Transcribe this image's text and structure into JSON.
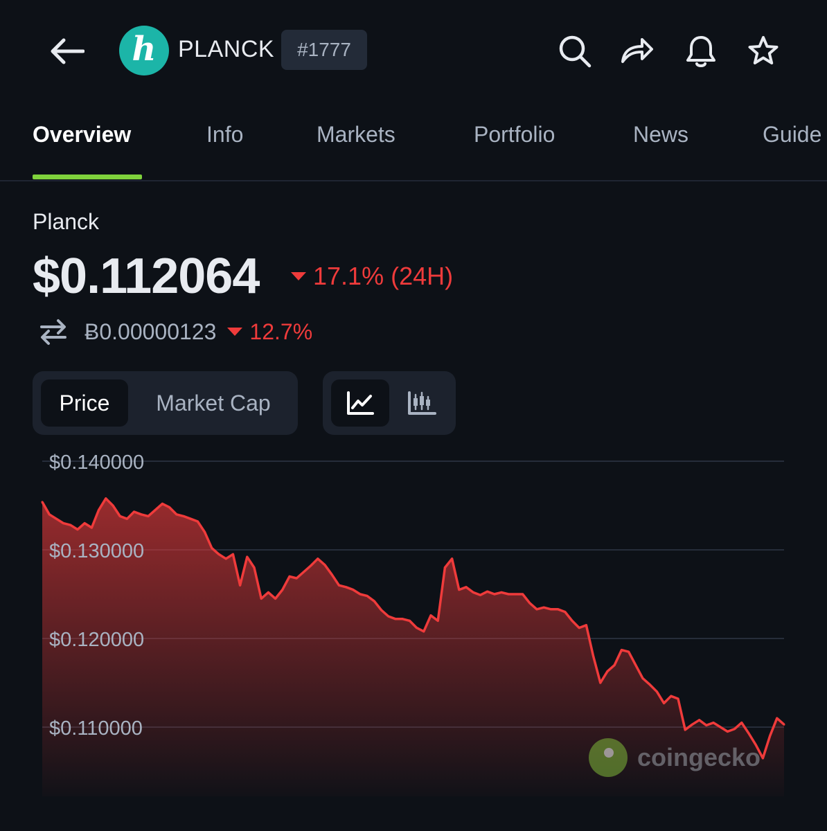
{
  "header": {
    "coin_logo_letter": "h",
    "symbol": "PLANCK",
    "rank": "#1777",
    "icons": [
      "back-arrow-icon",
      "search-icon",
      "share-icon",
      "bell-icon",
      "star-icon"
    ]
  },
  "tabs": [
    {
      "label": "Overview",
      "active": true
    },
    {
      "label": "Info",
      "active": false
    },
    {
      "label": "Markets",
      "active": false
    },
    {
      "label": "Portfolio",
      "active": false
    },
    {
      "label": "News",
      "active": false
    },
    {
      "label": "Guide",
      "active": false
    }
  ],
  "coin": {
    "name": "Planck",
    "price": "$0.112064",
    "change_24h": "17.1% (24H)",
    "btc_price": "Ƀ0.00000123",
    "btc_change": "12.7%"
  },
  "toggles": {
    "metric": [
      {
        "label": "Price",
        "active": true
      },
      {
        "label": "Market Cap",
        "active": false
      }
    ],
    "chart_type": [
      {
        "icon": "line-chart-icon",
        "active": true
      },
      {
        "icon": "candlestick-chart-icon",
        "active": false
      }
    ]
  },
  "colors": {
    "background": "#0d1117",
    "accent_green": "#7fd23c",
    "negative_red": "#ef3b3b",
    "coin_teal": "#1cb5a8"
  },
  "watermark": "coingecko",
  "chart_data": {
    "type": "area",
    "title": "",
    "xlabel": "",
    "ylabel": "",
    "ylim": [
      0.104,
      0.14
    ],
    "y_ticks": [
      "$0.140000",
      "$0.130000",
      "$0.120000",
      "$0.110000"
    ],
    "y_tick_values": [
      0.14,
      0.13,
      0.12,
      0.11
    ],
    "grid": true,
    "series": [
      {
        "values": [
          0.1354,
          0.134,
          0.1335,
          0.133,
          0.1328,
          0.1323,
          0.133,
          0.1325,
          0.1345,
          0.1358,
          0.135,
          0.1338,
          0.1335,
          0.1343,
          0.134,
          0.1338,
          0.1345,
          0.1352,
          0.1348,
          0.134,
          0.1338,
          0.1335,
          0.1332,
          0.132,
          0.1302,
          0.1295,
          0.129,
          0.1295,
          0.126,
          0.1292,
          0.128,
          0.1245,
          0.1252,
          0.1245,
          0.1255,
          0.127,
          0.1268,
          0.1275,
          0.1282,
          0.129,
          0.1283,
          0.1272,
          0.126,
          0.1258,
          0.1255,
          0.125,
          0.1248,
          0.1242,
          0.1232,
          0.1225,
          0.1222,
          0.1222,
          0.122,
          0.1212,
          0.1208,
          0.1226,
          0.122,
          0.128,
          0.129,
          0.1255,
          0.1258,
          0.1252,
          0.1249,
          0.1253,
          0.125,
          0.1252,
          0.125,
          0.125,
          0.125,
          0.124,
          0.1233,
          0.1235,
          0.1233,
          0.1233,
          0.123,
          0.122,
          0.1212,
          0.1215,
          0.118,
          0.115,
          0.1163,
          0.117,
          0.1187,
          0.1185,
          0.117,
          0.1155,
          0.1148,
          0.114,
          0.1127,
          0.1135,
          0.1132,
          0.1097,
          0.1103,
          0.1108,
          0.1102,
          0.1105,
          0.11,
          0.1095,
          0.1098,
          0.1105,
          0.1093,
          0.108,
          0.1065,
          0.109,
          0.111,
          0.1103
        ]
      }
    ]
  }
}
